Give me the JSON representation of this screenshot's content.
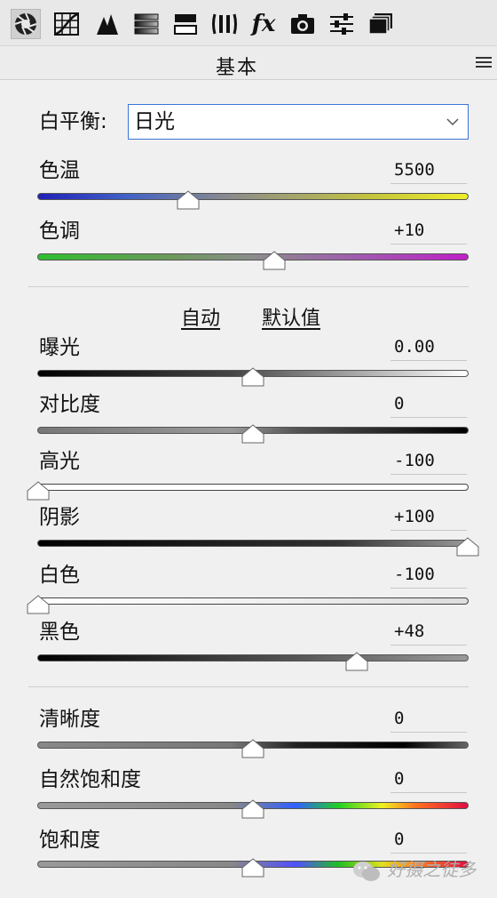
{
  "toolbar": {
    "tools": [
      {
        "icon": "aperture-icon",
        "active": true
      },
      {
        "icon": "tone-curve-icon"
      },
      {
        "icon": "detail-triangles-icon"
      },
      {
        "icon": "hsl-gradient-icon"
      },
      {
        "icon": "split-toning-icon"
      },
      {
        "icon": "lens-corrections-icon"
      },
      {
        "icon": "fx-icon",
        "text": "fx"
      },
      {
        "icon": "camera-icon"
      },
      {
        "icon": "presets-sliders-icon"
      },
      {
        "icon": "snapshots-icon"
      }
    ]
  },
  "panel": {
    "title": "基本",
    "white_balance": {
      "label": "白平衡:",
      "value": "日光"
    },
    "temperature": {
      "label": "色温",
      "value": "5500"
    },
    "tint": {
      "label": "色调",
      "value": "+10"
    },
    "auto_label": "自动",
    "default_label": "默认值",
    "exposure": {
      "label": "曝光",
      "value": "0.00"
    },
    "contrast": {
      "label": "对比度",
      "value": "0"
    },
    "highlights": {
      "label": "高光",
      "value": "-100"
    },
    "shadows": {
      "label": "阴影",
      "value": "+100"
    },
    "whites": {
      "label": "白色",
      "value": "-100"
    },
    "blacks": {
      "label": "黑色",
      "value": "+48"
    },
    "clarity": {
      "label": "清晰度",
      "value": "0"
    },
    "vibrance": {
      "label": "自然饱和度",
      "value": "0"
    },
    "saturation": {
      "label": "饱和度",
      "value": "0"
    }
  },
  "slider_levels": {
    "temperature": 0.35,
    "tint": 0.55,
    "exposure": 0.5,
    "contrast": 0.5,
    "highlights": 0.0,
    "shadows": 1.0,
    "whites": 0.0,
    "blacks": 0.74,
    "clarity": 0.5,
    "vibrance": 0.5,
    "saturation": 0.5
  },
  "watermark": {
    "text": "好摄之徒多"
  }
}
